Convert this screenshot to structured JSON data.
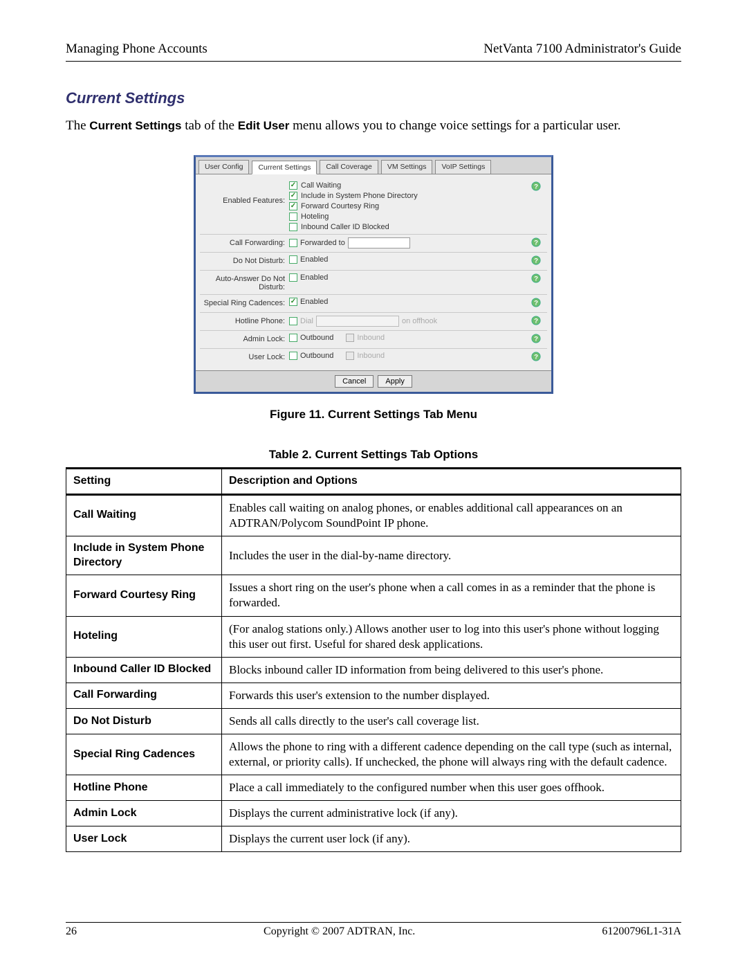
{
  "header": {
    "left": "Managing Phone Accounts",
    "right": "NetVanta 7100 Administrator's Guide"
  },
  "section_title": "Current Settings",
  "intro_pre": "The ",
  "intro_b1": "Current Settings",
  "intro_mid": " tab of the ",
  "intro_b2": "Edit User",
  "intro_post": " menu allows you to change voice settings for a particular user.",
  "tabs": {
    "items": [
      {
        "label": "User Config"
      },
      {
        "label": "Current Settings"
      },
      {
        "label": "Call Coverage"
      },
      {
        "label": "VM Settings"
      },
      {
        "label": "VoIP Settings"
      }
    ]
  },
  "rows": {
    "features": {
      "label": "Enabled Features:",
      "items": [
        {
          "label": "Call Waiting"
        },
        {
          "label": "Include in System Phone Directory"
        },
        {
          "label": "Forward Courtesy Ring"
        },
        {
          "label": "Hoteling"
        },
        {
          "label": "Inbound Caller ID Blocked"
        }
      ]
    },
    "cf": {
      "label": "Call Forwarding:",
      "text": "Forwarded to"
    },
    "dnd": {
      "label": "Do Not Disturb:",
      "text": "Enabled"
    },
    "aadnd": {
      "label": "Auto-Answer Do Not Disturb:",
      "text": "Enabled"
    },
    "src": {
      "label": "Special Ring Cadences:",
      "text": "Enabled"
    },
    "hot": {
      "label": "Hotline Phone:",
      "dial": "Dial",
      "hook": "on offhook"
    },
    "alock": {
      "label": "Admin Lock:",
      "out": "Outbound",
      "in": "Inbound"
    },
    "ulock": {
      "label": "User Lock:",
      "out": "Outbound",
      "in": "Inbound"
    }
  },
  "buttons": {
    "cancel": "Cancel",
    "apply": "Apply"
  },
  "figure_caption": "Figure 11.  Current Settings Tab Menu",
  "table_caption": "Table 2.  Current Settings Tab Options",
  "table": {
    "h1": "Setting",
    "h2": "Description and Options",
    "rows": [
      {
        "s": "Call Waiting",
        "d": "Enables call waiting on analog phones, or enables additional call appearances on an ADTRAN/Polycom SoundPoint IP phone."
      },
      {
        "s": "Include in System Phone Directory",
        "d": "Includes the user in the dial-by-name directory."
      },
      {
        "s": "Forward Courtesy Ring",
        "d": "Issues a short ring on the user's phone when a call comes in as a reminder that the phone is forwarded."
      },
      {
        "s": "Hoteling",
        "d": "(For analog stations only.) Allows another user to log into this user's phone without logging this user out first. Useful for shared desk applications."
      },
      {
        "s": "Inbound Caller ID Blocked",
        "d": "Blocks inbound caller ID information from being delivered to this user's phone."
      },
      {
        "s": "Call Forwarding",
        "d": "Forwards this user's extension to the number displayed."
      },
      {
        "s": "Do Not Disturb",
        "d": "Sends all calls directly to the user's call coverage list."
      },
      {
        "s": "Special Ring Cadences",
        "d": "Allows the phone to ring with a different cadence depending on the call type (such as internal, external, or priority calls). If unchecked, the phone will always ring with the default cadence."
      },
      {
        "s": "Hotline Phone",
        "d": "Place a call immediately to the configured number when this user goes offhook."
      },
      {
        "s": "Admin Lock",
        "d": "Displays the current administrative lock (if any)."
      },
      {
        "s": "User Lock",
        "d": "Displays the current user lock (if any)."
      }
    ]
  },
  "footer": {
    "page": "26",
    "copy": "Copyright © 2007 ADTRAN, Inc.",
    "doc": "61200796L1-31A"
  }
}
